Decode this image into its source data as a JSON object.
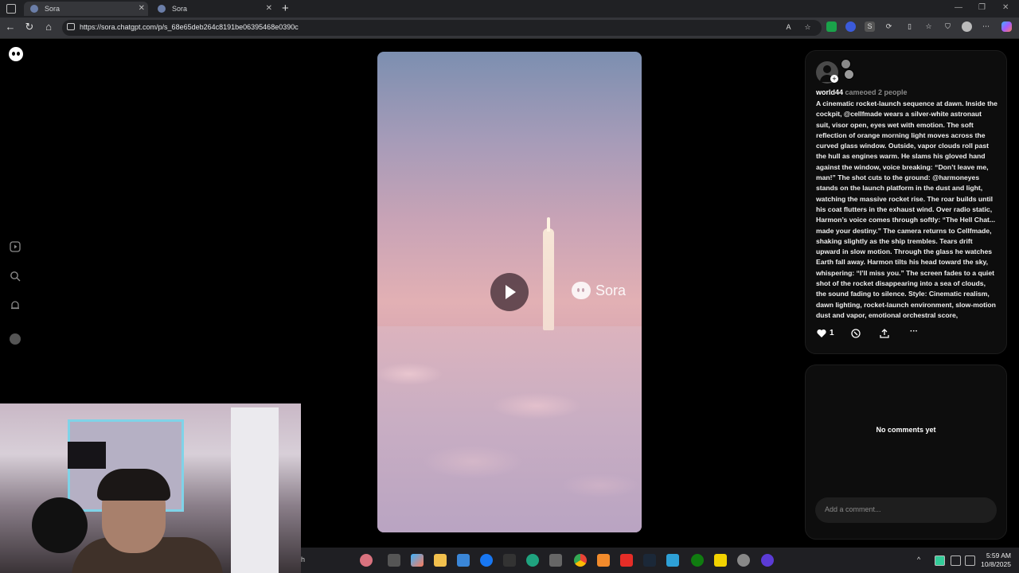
{
  "browser": {
    "tabs": [
      {
        "label": "Sora",
        "active": true
      },
      {
        "label": "Sora",
        "active": false
      }
    ],
    "url": "https://sora.chatgpt.com/p/s_68e65deb264c8191be06395468e0390c",
    "read_aloud_label": "A",
    "ext_s_label": "S"
  },
  "sidebar": {
    "items": [
      "video-icon",
      "search-icon",
      "bell-icon",
      "avatar"
    ]
  },
  "video": {
    "watermark": "Sora",
    "state": "paused"
  },
  "post": {
    "username": "world44",
    "cameo_text": "cameoed 2 people",
    "description": "A cinematic rocket-launch sequence at dawn. Inside the cockpit, @cellfmade wears a silver-white astronaut suit, visor open, eyes wet with emotion. The soft reflection of orange morning light moves across the curved glass window. Outside, vapor clouds roll past the hull as engines warm. He slams his gloved hand against the window, voice breaking: “Don’t leave me, man!” The shot cuts to the ground: @harmoneyes stands on the launch platform in the dust and light, watching the massive rocket rise. The roar builds until his coat flutters in the exhaust wind. Over radio static, Harmon’s voice comes through softly: “The Hell Chat... made your destiny.” The camera returns to Cellfmade, shaking slightly as the ship trembles. Tears drift upward in slow motion. Through the glass he watches Earth fall away. Harmon tilts his head toward the sky, whispering: “I’ll miss you.” The screen fades to a quiet shot of the rocket disappearing into a sea of clouds, the sound fading to silence. Style: Cinematic realism, dawn lighting, rocket-launch environment, slow-motion dust and vapor, emotional orchestral score,",
    "likes": "1",
    "more_label": "···"
  },
  "comments": {
    "empty_text": "No comments yet",
    "placeholder": "Add a comment..."
  },
  "taskbar": {
    "search_fragment": "h",
    "time": "5:59 AM",
    "date": "10/8/2025"
  }
}
